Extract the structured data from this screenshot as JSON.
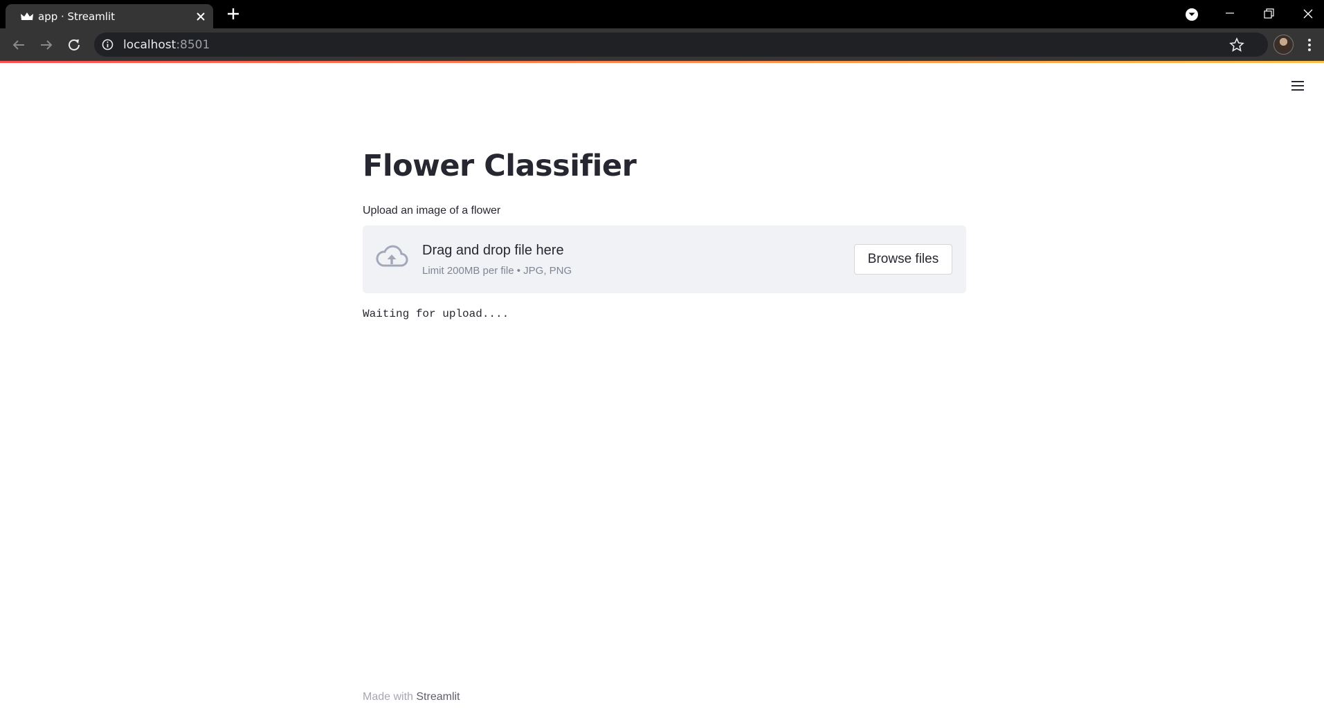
{
  "browser": {
    "tab_title": "app · Streamlit",
    "url_host": "localhost",
    "url_port": ":8501"
  },
  "page": {
    "title": "Flower Classifier",
    "upload_label": "Upload an image of a flower",
    "dropzone_title": "Drag and drop file here",
    "dropzone_hint": "Limit 200MB per file • JPG, PNG",
    "browse_button": "Browse files",
    "status_text": "Waiting for upload....",
    "footer_prefix": "Made with ",
    "footer_link": "Streamlit"
  },
  "colors": {
    "accent_start": "#ff4b4b",
    "accent_end": "#ffbd45",
    "text": "#262730",
    "dropzone_bg": "#f0f2f6"
  },
  "icons": {
    "favicon": "streamlit-crown-icon",
    "upload": "cloud-upload-icon",
    "menu": "hamburger-menu-icon"
  }
}
